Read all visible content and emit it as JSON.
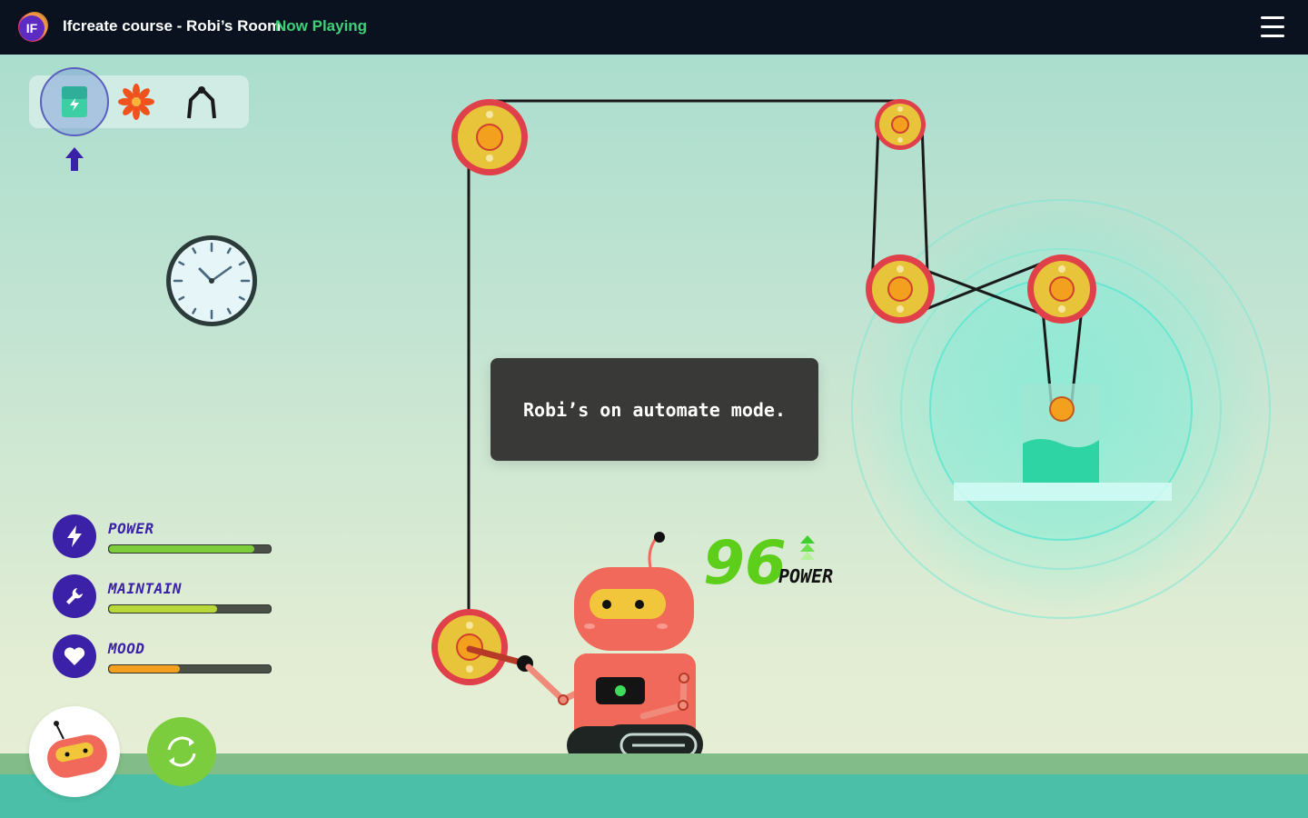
{
  "header": {
    "logo_text": "IF",
    "title": "Ifcreate course - Robi’s Room",
    "status": "Now Playing"
  },
  "toolbar": {
    "tools": [
      {
        "icon": "battery-icon",
        "selected": true
      },
      {
        "icon": "gear-flower-icon",
        "selected": false
      },
      {
        "icon": "claw-icon",
        "selected": false
      }
    ]
  },
  "stats": [
    {
      "label": "POWER",
      "icon": "lightning-icon",
      "level": 0.9,
      "color": "#7dcc3a"
    },
    {
      "label": "MAINTAIN",
      "icon": "wrench-icon",
      "level": 0.67,
      "color": "#b8d83a"
    },
    {
      "label": "MOOD",
      "icon": "heart-icon",
      "level": 0.44,
      "color": "#f2a01e"
    }
  ],
  "dialog": {
    "message": "Robi’s on automate mode."
  },
  "power_readout": {
    "value": "96",
    "label": "POWER"
  },
  "colors": {
    "accent_purple": "#3a21a8",
    "pulley_rim": "#e0404a",
    "pulley_fill": "#e8c43a",
    "robot_body": "#f0695a",
    "power_green": "#5dcf1a"
  }
}
